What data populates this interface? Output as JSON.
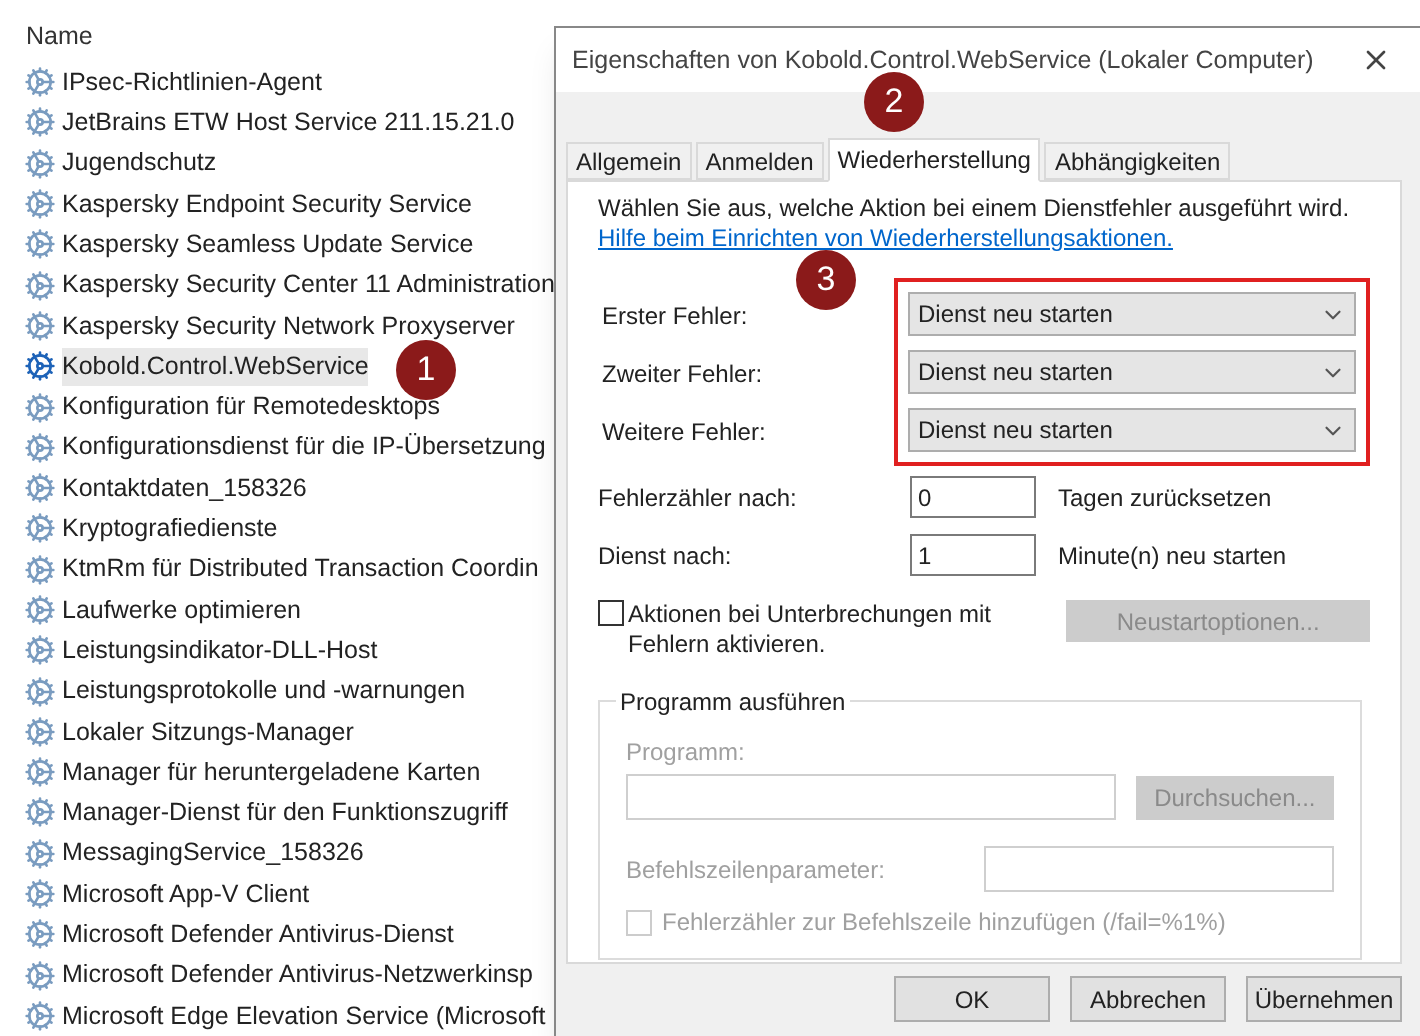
{
  "services": {
    "column_header": "Name",
    "items": [
      {
        "name": "IPsec-Richtlinien-Agent",
        "selected": false
      },
      {
        "name": "JetBrains ETW Host Service 211.15.21.0",
        "selected": false
      },
      {
        "name": "Jugendschutz",
        "selected": false
      },
      {
        "name": "Kaspersky Endpoint Security Service",
        "selected": false
      },
      {
        "name": "Kaspersky Seamless Update Service",
        "selected": false
      },
      {
        "name": "Kaspersky Security Center 11 Administration",
        "selected": false
      },
      {
        "name": "Kaspersky Security Network Proxyserver",
        "selected": false
      },
      {
        "name": "Kobold.Control.WebService",
        "selected": true
      },
      {
        "name": "Konfiguration für Remotedesktops",
        "selected": false
      },
      {
        "name": "Konfigurationsdienst für die IP-Übersetzung",
        "selected": false
      },
      {
        "name": "Kontaktdaten_158326",
        "selected": false
      },
      {
        "name": "Kryptografiedienste",
        "selected": false
      },
      {
        "name": "KtmRm für Distributed Transaction Coordin",
        "selected": false
      },
      {
        "name": "Laufwerke optimieren",
        "selected": false
      },
      {
        "name": "Leistungsindikator-DLL-Host",
        "selected": false
      },
      {
        "name": "Leistungsprotokolle und -warnungen",
        "selected": false
      },
      {
        "name": "Lokaler Sitzungs-Manager",
        "selected": false
      },
      {
        "name": "Manager für heruntergeladene Karten",
        "selected": false
      },
      {
        "name": "Manager-Dienst für den Funktionszugriff",
        "selected": false
      },
      {
        "name": "MessagingService_158326",
        "selected": false
      },
      {
        "name": "Microsoft App-V Client",
        "selected": false
      },
      {
        "name": "Microsoft Defender Antivirus-Dienst",
        "selected": false
      },
      {
        "name": "Microsoft Defender Antivirus-Netzwerkinsp",
        "selected": false
      },
      {
        "name": "Microsoft Edge Elevation Service (Microsoft",
        "selected": false
      }
    ]
  },
  "dialog": {
    "title": "Eigenschaften von Kobold.Control.WebService (Lokaler Computer)",
    "tabs": [
      {
        "label": "Allgemein",
        "selected": false
      },
      {
        "label": "Anmelden",
        "selected": false
      },
      {
        "label": "Wiederherstellung",
        "selected": true
      },
      {
        "label": "Abhängigkeiten",
        "selected": false
      }
    ],
    "intro": "Wählen Sie aus, welche Aktion bei einem Dienstfehler ausgeführt wird.",
    "help_link": "Hilfe beim Einrichten von Wiederherstellungsaktionen.",
    "failure_actions": [
      {
        "label": "Erster Fehler:",
        "value": "Dienst neu starten"
      },
      {
        "label": "Zweiter Fehler:",
        "value": "Dienst neu starten"
      },
      {
        "label": "Weitere Fehler:",
        "value": "Dienst neu starten"
      }
    ],
    "counters": [
      {
        "label": "Fehlerzähler nach:",
        "value": "0",
        "unit": "Tagen zurücksetzen"
      },
      {
        "label": "Dienst nach:",
        "value": "1",
        "unit": "Minute(n) neu starten"
      }
    ],
    "enable_actions": {
      "label": "Aktionen bei Unterbrechungen mit Fehlern aktivieren.",
      "checked": false
    },
    "restart_options": {
      "label": "Neustartoptionen...",
      "disabled": true
    },
    "run_program": {
      "title": "Programm ausführen",
      "disabled": true,
      "program_label": "Programm:",
      "browse_button": "Durchsuchen...",
      "params_label": "Befehlszeilenparameter:",
      "append_checkbox": {
        "label": "Fehlerzähler zur Befehlszeile hinzufügen (/fail=%1%)",
        "checked": false
      }
    },
    "buttons": [
      "OK",
      "Abbrechen",
      "Übernehmen"
    ]
  },
  "annotations": [
    {
      "label": "1"
    },
    {
      "label": "2"
    },
    {
      "label": "3"
    }
  ]
}
